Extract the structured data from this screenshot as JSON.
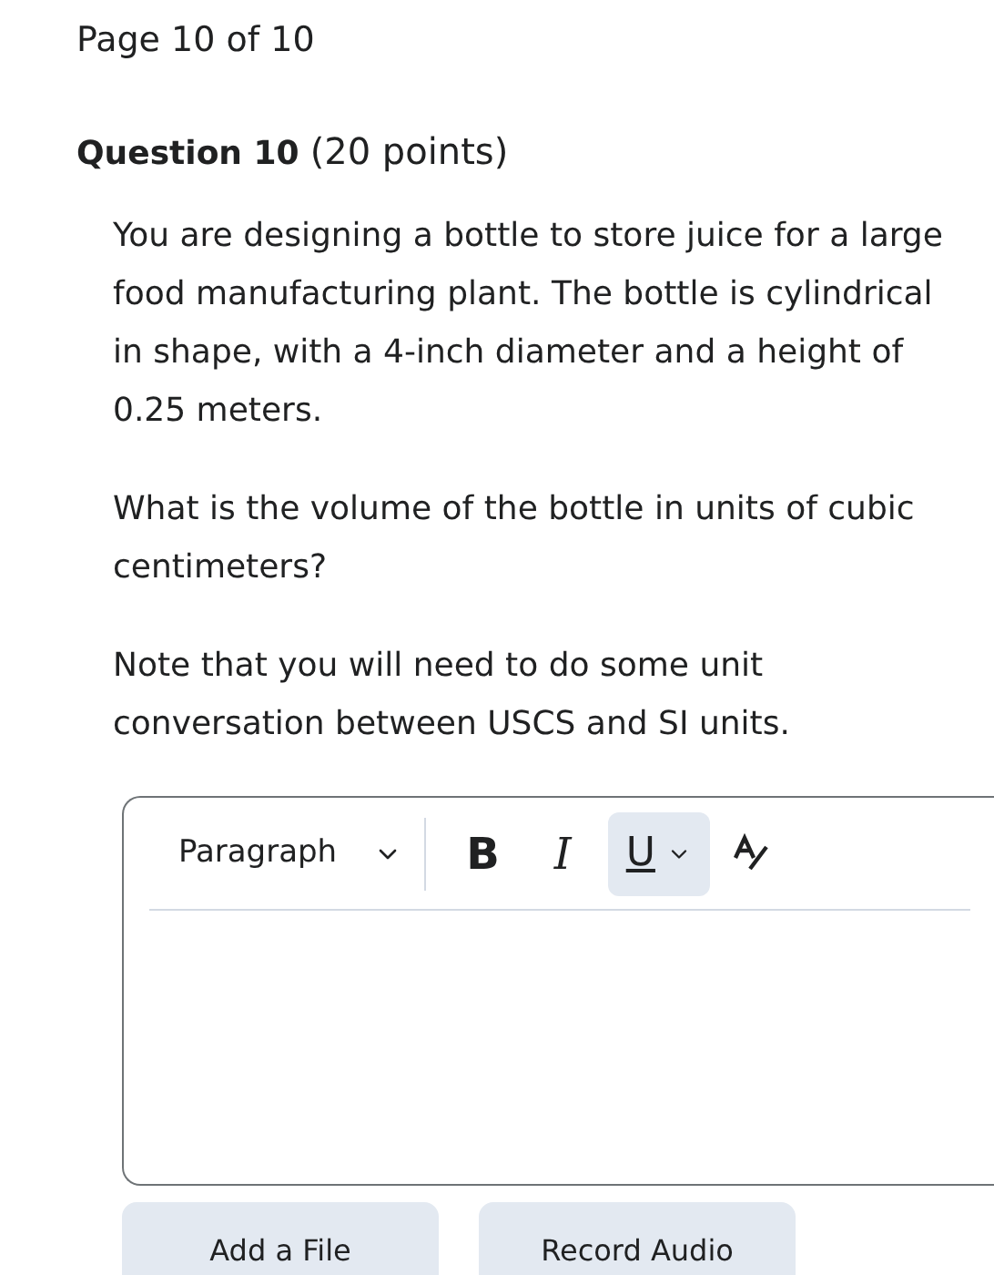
{
  "page_label": "Page 10 of 10",
  "question": {
    "title": "Question 10",
    "points": "(20 points)"
  },
  "paragraphs": [
    "You are designing a bottle to store juice for a large food manufacturing plant. The bottle is cylindrical in shape, with a 4-inch diameter and a height of 0.25 meters.",
    "What is the volume of the bottle in units of cubic centimeters?",
    "Note that you will need to do some unit conversation between USCS and SI units."
  ],
  "editor": {
    "format_select": "Paragraph",
    "tools": [
      {
        "kind": "bold",
        "label": "B",
        "selected": false
      },
      {
        "kind": "italic",
        "label": "I",
        "selected": false
      },
      {
        "kind": "underline",
        "label": "U",
        "selected": true
      }
    ]
  },
  "buttons": [
    "Add a File",
    "Record Audio"
  ]
}
